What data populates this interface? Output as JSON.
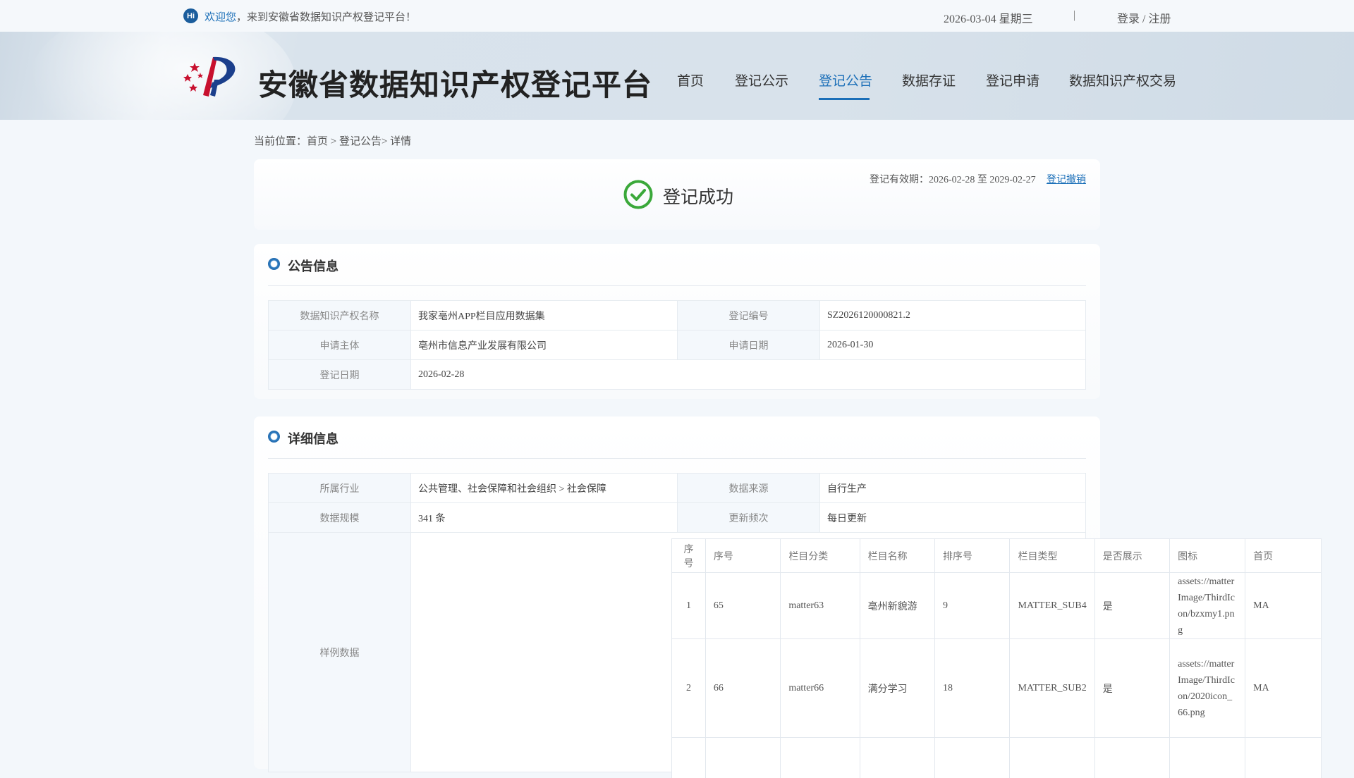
{
  "topbar": {
    "hi_badge": "Hi",
    "welcome_highlight": "欢迎您",
    "welcome_rest": "，来到安徽省数据知识产权登记平台！",
    "date": "2026-03-04 星期三",
    "separator": "|",
    "login": "登录 / 注册"
  },
  "header": {
    "site_title": "安徽省数据知识产权登记平台",
    "nav": [
      {
        "label": "首页"
      },
      {
        "label": "登记公示"
      },
      {
        "label": "登记公告",
        "active": true
      },
      {
        "label": "数据存证"
      },
      {
        "label": "登记申请"
      },
      {
        "label": "数据知识产权交易"
      }
    ]
  },
  "breadcrumb": "当前位置：首页 > 登记公告> 详情",
  "status": {
    "text": "登记成功",
    "validity": "登记有效期：2026-02-28 至 2029-02-27",
    "revoke": "登记撤销",
    "icon": "check-circle-icon",
    "color": "#3aa83a"
  },
  "notice": {
    "title": "公告信息",
    "rows": [
      {
        "k1": "数据知识产权名称",
        "v1": "我家亳州APP栏目应用数据集",
        "k2": "登记编号",
        "v2": "SZ2026120000821.2"
      },
      {
        "k1": "申请主体",
        "v1": "亳州市信息产业发展有限公司",
        "k2": "申请日期",
        "v2": "2026-01-30"
      },
      {
        "k1": "登记日期",
        "v1": "2026-02-28"
      }
    ]
  },
  "detail": {
    "title": "详细信息",
    "rows": [
      {
        "k1": "所属行业",
        "v1": "公共管理、社会保障和社会组织 > 社会保障",
        "k2": "数据来源",
        "v2": "自行生产"
      },
      {
        "k1": "数据规模",
        "v1": "341 条",
        "k2": "更新频次",
        "v2": "每日更新"
      }
    ],
    "sample_label": "样例数据",
    "sample": {
      "headers": [
        "序号",
        "序号",
        "栏目分类",
        "栏目名称",
        "排序号",
        "栏目类型",
        "是否展示",
        "图标",
        "首页"
      ],
      "rows": [
        [
          "1",
          "65",
          "matter63",
          "亳州新貌游",
          "9",
          "MATTER_SUB4",
          "是",
          "assets://matterImage/ThirdIcon/bzxmy1.png",
          "MA"
        ],
        [
          "2",
          "66",
          "matter66",
          "满分学习",
          "18",
          "MATTER_SUB2",
          "是",
          "assets://matterImage/ThirdIcon/2020icon_66.png",
          "MA"
        ]
      ]
    }
  },
  "colors": {
    "accent": "#1b6fb8",
    "success": "#3aa83a"
  }
}
